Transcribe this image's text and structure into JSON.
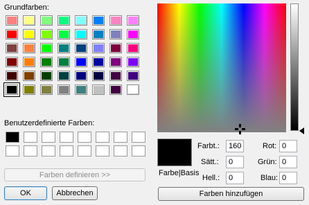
{
  "dialog": {
    "basic_colors_label": "Grundfarben:",
    "custom_colors_label": "Benutzerdefinierte Farben:",
    "define_custom_button": "Farben definieren >>",
    "ok_button": "OK",
    "cancel_button": "Abbrechen",
    "add_to_custom_button": "Farben hinzufügen",
    "preview_label": "Farbe|Basis"
  },
  "basic_colors": [
    "#ff8080",
    "#ffff80",
    "#80ff80",
    "#00ff80",
    "#80ffff",
    "#0080ff",
    "#ff80c0",
    "#ff80ff",
    "#ff0000",
    "#ffff00",
    "#80ff00",
    "#00ff40",
    "#00ffff",
    "#0080c0",
    "#8080c0",
    "#ff00ff",
    "#804040",
    "#ff8040",
    "#00ff00",
    "#008080",
    "#004080",
    "#8080ff",
    "#800040",
    "#ff0080",
    "#800000",
    "#ff8000",
    "#008000",
    "#008040",
    "#0000ff",
    "#0000a0",
    "#800080",
    "#8000ff",
    "#400000",
    "#804000",
    "#004000",
    "#004040",
    "#000080",
    "#000040",
    "#400040",
    "#400080",
    "#000000",
    "#808000",
    "#808040",
    "#808080",
    "#408080",
    "#c0c0c0",
    "#400040",
    "#ffffff"
  ],
  "selected_basic_index": 40,
  "custom_colors": [
    "#000000",
    "#ffffff",
    "#ffffff",
    "#ffffff",
    "#ffffff",
    "#ffffff",
    "#ffffff",
    "#ffffff",
    "#ffffff",
    "#ffffff",
    "#ffffff",
    "#ffffff",
    "#ffffff",
    "#ffffff",
    "#ffffff",
    "#ffffff"
  ],
  "fields": {
    "hue": {
      "label": "Farbt.:",
      "value": "160"
    },
    "sat": {
      "label": "Sätt.:",
      "value": "0"
    },
    "lum": {
      "label": "Hell.:",
      "value": "0"
    },
    "red": {
      "label": "Rot:",
      "value": "0"
    },
    "green": {
      "label": "Grün:",
      "value": "0"
    },
    "blue": {
      "label": "Blau:",
      "value": "0"
    }
  },
  "current_color": "#000000"
}
